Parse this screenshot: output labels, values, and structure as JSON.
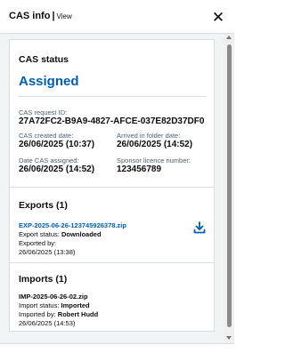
{
  "header": {
    "title": "CAS info",
    "separator": "|",
    "view_label": "View",
    "close_icon": "✕"
  },
  "status_card": {
    "heading": "CAS status",
    "status": "Assigned",
    "request_id_label": "CAS request ID:",
    "request_id": "27A72FC2-B9A9-4827-AFCE-037E82D37DF0",
    "created_label": "CAS created date:",
    "created": "26/06/2025 (10:37)",
    "arrived_label": "Arrived in folder date:",
    "arrived": "26/06/2025 (14:52)",
    "assigned_label": "Date CAS assigned:",
    "assigned": "26/06/2025 (14:52)",
    "sponsor_label": "Sponsor licence number:",
    "sponsor": "123456789",
    "status_color": "#005eb8"
  },
  "exports_card": {
    "heading": "Exports (1)",
    "file": "EXP-2025-06-26-123745926378.zip",
    "status_prefix": "Export status:",
    "status": "Downloaded",
    "exported_by_label": "Exported by:",
    "exported_at": "26/06/2025 (13:38)",
    "action_icon": "download-icon"
  },
  "imports_card": {
    "heading": "Imports (1)",
    "file": "IMP-2025-06-26-02.zip",
    "status_prefix": "Import status:",
    "status": "Imported",
    "imported_by_prefix": "Imported by:",
    "imported_by": "Robert Hudd",
    "imported_at": "26/06/2025 (14:53)"
  }
}
